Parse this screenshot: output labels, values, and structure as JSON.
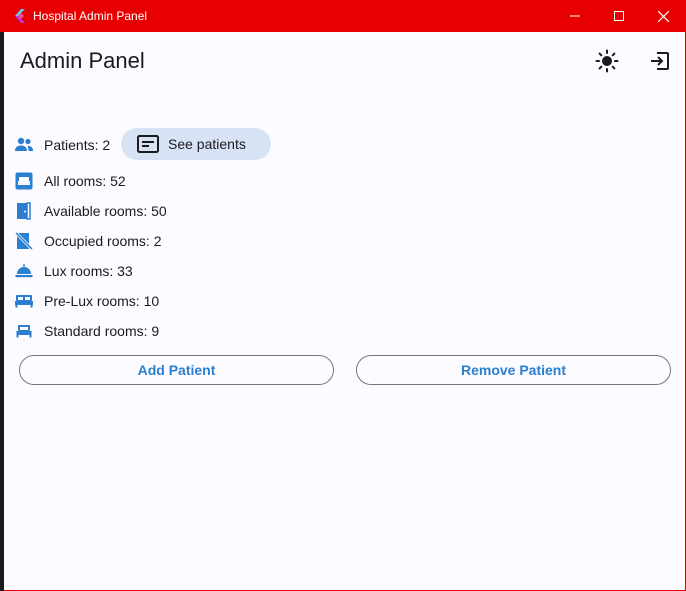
{
  "window": {
    "title": "Hospital Admin Panel",
    "colors": {
      "titlebar": "#e80000",
      "accent": "#2a7fd1",
      "chip": "#d8e2f5"
    }
  },
  "header": {
    "title": "Admin Panel",
    "theme_icon": "sun-icon",
    "logout_icon": "logout-icon"
  },
  "patients": {
    "label": "Patients: 2",
    "icon": "people-icon",
    "see_button": {
      "label": "See patients",
      "icon": "card-icon"
    }
  },
  "stats": [
    {
      "label": "All rooms: 52",
      "icon": "bed-icon"
    },
    {
      "label": "Available rooms: 50",
      "icon": "door-open-icon"
    },
    {
      "label": "Occupied rooms: 2",
      "icon": "door-closed-icon"
    },
    {
      "label": "Lux rooms: 33",
      "icon": "room-service-icon"
    },
    {
      "label": "Pre-Lux rooms: 10",
      "icon": "king-bed-icon"
    },
    {
      "label": "Standard rooms: 9",
      "icon": "single-bed-icon"
    }
  ],
  "actions": {
    "add_label": "Add Patient",
    "remove_label": "Remove Patient"
  }
}
